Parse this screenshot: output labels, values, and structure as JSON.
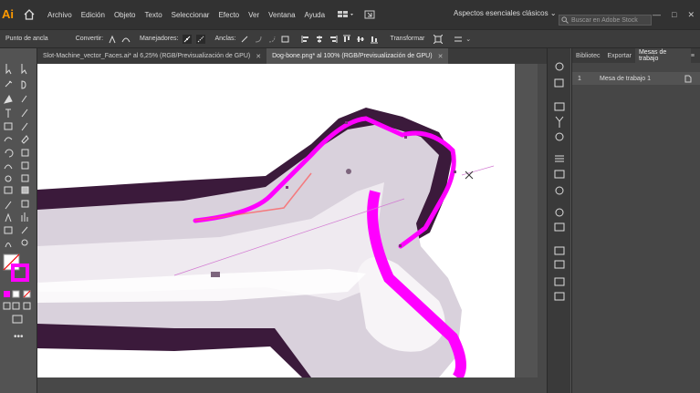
{
  "app": {
    "logo": "Ai",
    "menu": [
      "Archivo",
      "Edición",
      "Objeto",
      "Texto",
      "Seleccionar",
      "Efecto",
      "Ver",
      "Ventana",
      "Ayuda"
    ],
    "workspace": "Aspectos esenciales clásicos",
    "search_placeholder": "Buscar en Adobe Stock"
  },
  "controlbar": {
    "selection_label": "Punto de ancla",
    "convert_label": "Convertir:",
    "handles_label": "Manejadores:",
    "anchors_label": "Anclas:",
    "transform_label": "Transformar"
  },
  "tabs": [
    {
      "label": "Slot-Machine_vector_Faces.ai* al 6,25% (RGB/Previsualización de GPU)",
      "active": false
    },
    {
      "label": "Dog-bone.png* al 100% (RGB/Previsualización de GPU)",
      "active": true
    }
  ],
  "panel": {
    "tabs": [
      "Bibliotec",
      "Exportar",
      "Mesas de trabajo"
    ],
    "artboards": [
      {
        "index": "1",
        "name": "Mesa de trabajo 1"
      }
    ]
  },
  "colors": {
    "stroke": "#ff00ff",
    "shadow": "#3b1a3b",
    "bone": "#d9d1dc"
  }
}
